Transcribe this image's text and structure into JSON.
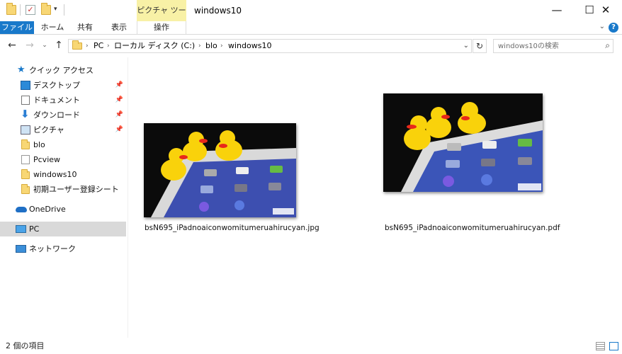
{
  "window": {
    "title": "windows10"
  },
  "ribbon": {
    "context_header": "ピクチャ ツール",
    "tabs": [
      "ファイル",
      "ホーム",
      "共有",
      "表示",
      "操作"
    ]
  },
  "address": {
    "breadcrumbs": [
      "PC",
      "ローカル ディスク (C:)",
      "blo",
      "windows10"
    ]
  },
  "search": {
    "placeholder": "windows10の検索"
  },
  "nav": {
    "quick_access": "クイック アクセス",
    "pinned": [
      {
        "label": "デスクトップ",
        "icon": "desktop-icon"
      },
      {
        "label": "ドキュメント",
        "icon": "documents-icon"
      },
      {
        "label": "ダウンロード",
        "icon": "downloads-icon"
      },
      {
        "label": "ピクチャ",
        "icon": "pictures-icon"
      }
    ],
    "folders": [
      "blo",
      "Pcview",
      "windows10",
      "初期ユーザー登録シート"
    ],
    "onedrive": "OneDrive",
    "pc": "PC",
    "network": "ネットワーク"
  },
  "files": [
    {
      "name": "bsN695_iPadnoaiconwomitumeruahirucyan.jpg"
    },
    {
      "name": "bsN695_iPadnoaiconwomitumeruahirucyan.pdf"
    }
  ],
  "status": {
    "text": "2 個の項目"
  },
  "colors": {
    "accent": "#1979ca",
    "context_tab": "#f8f1a6",
    "folder": "#f8d775",
    "selected": "#d9d9d9"
  }
}
